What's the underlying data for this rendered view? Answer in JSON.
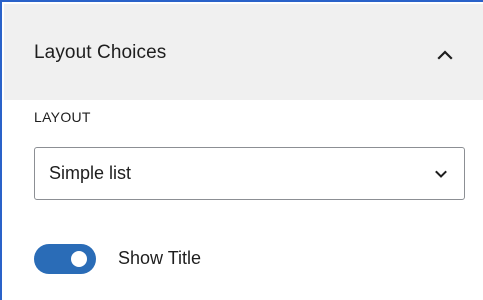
{
  "panel": {
    "title": "Layout Choices",
    "collapse_icon": "chevron-up-icon"
  },
  "layout_section": {
    "label": "LAYOUT",
    "select": {
      "value": "Simple list",
      "icon": "chevron-down-icon"
    }
  },
  "show_title_toggle": {
    "label": "Show Title",
    "checked": true
  },
  "colors": {
    "accent": "#2a6cb7",
    "frame_border": "#2a62c9",
    "header_background": "#f0f0f0",
    "text": "#1e1e1e",
    "select_border": "#8c8f94"
  }
}
